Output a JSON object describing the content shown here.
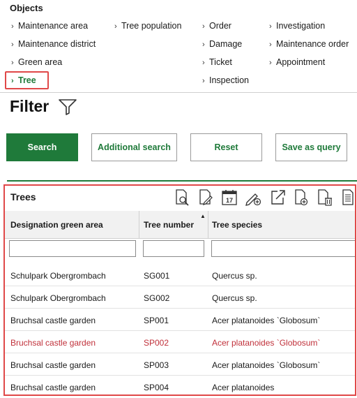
{
  "objects": {
    "title": "Objects",
    "links": {
      "maintenance_area": "Maintenance area",
      "tree_population": "Tree population",
      "order": "Order",
      "investigation": "Investigation",
      "maintenance_district": "Maintenance district",
      "damage": "Damage",
      "maintenance_order": "Maintenance order",
      "green_area": "Green area",
      "ticket": "Ticket",
      "appointment": "Appointment",
      "tree": "Tree",
      "inspection": "Inspection"
    },
    "chevron": "›"
  },
  "filter": {
    "title": "Filter",
    "icon": "funnel-icon",
    "buttons": {
      "search": "Search",
      "additional_search": "Additional search",
      "reset": "Reset",
      "save_as_query": "Save as query"
    }
  },
  "trees": {
    "title": "Trees",
    "calendar_day": "17",
    "toolbar_icons": [
      "magnify-document-icon",
      "edit-document-icon",
      "calendar-icon",
      "pencil-add-icon",
      "export-icon",
      "add-document-icon",
      "delete-document-icon",
      "report-icon"
    ],
    "columns": {
      "designation": "Designation green area",
      "tree_number": "Tree number",
      "species": "Tree species"
    },
    "sort_indicator": "▲",
    "rows": [
      {
        "designation": "Schulpark Obergrombach",
        "number": "SG001",
        "species": "Quercus sp."
      },
      {
        "designation": "Schulpark Obergrombach",
        "number": "SG002",
        "species": "Quercus sp."
      },
      {
        "designation": "Bruchsal castle garden",
        "number": "SP001",
        "species": "Acer platanoides `Globosum`"
      },
      {
        "designation": "Bruchsal castle garden",
        "number": "SP002",
        "species": "Acer platanoides `Globosum`"
      },
      {
        "designation": "Bruchsal castle garden",
        "number": "SP003",
        "species": "Acer platanoides `Globosum`"
      },
      {
        "designation": "Bruchsal castle garden",
        "number": "SP004",
        "species": "Acer platanoides"
      }
    ],
    "selected_row": 3
  },
  "colors": {
    "accent_green": "#1f7a3a",
    "highlight_red": "#e04848",
    "selected_text": "#c0303a"
  }
}
